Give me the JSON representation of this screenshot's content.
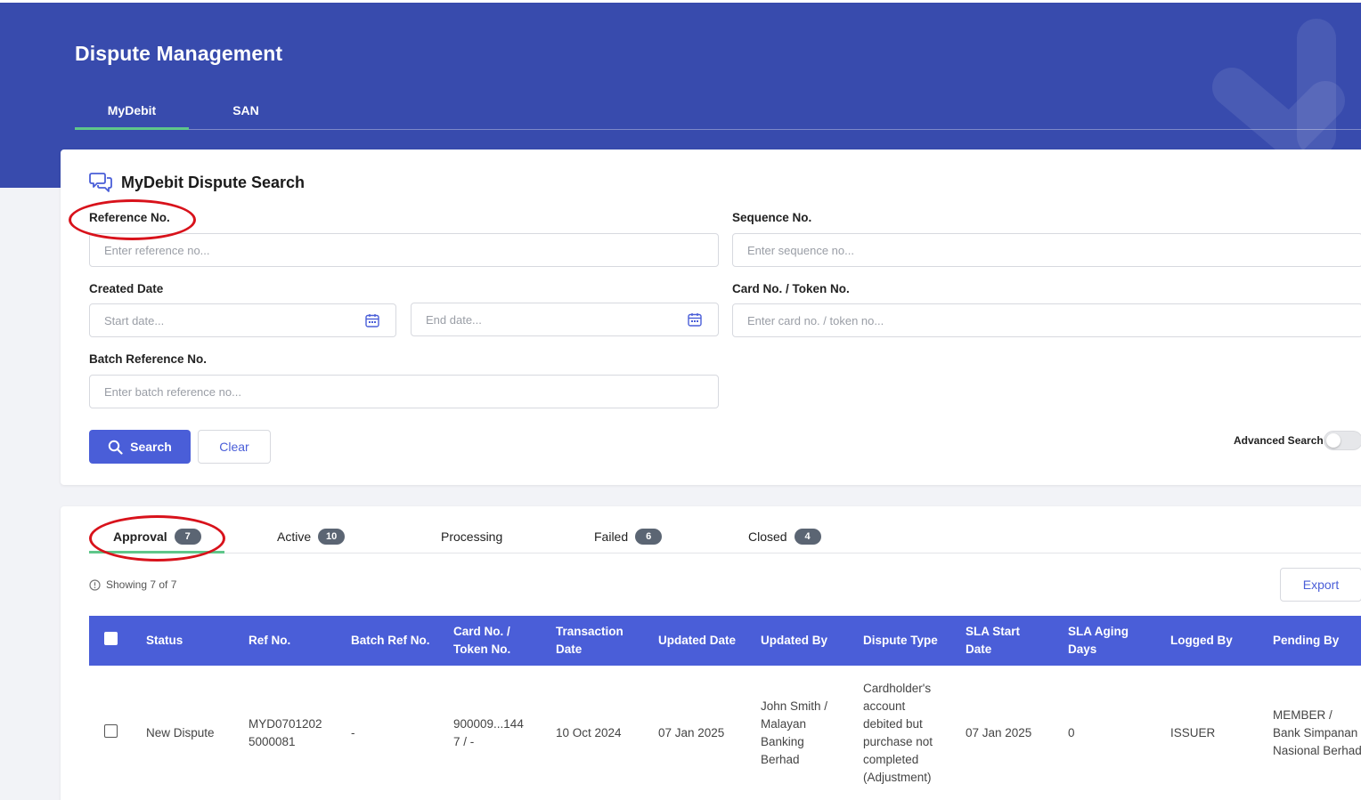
{
  "page": {
    "title": "Dispute Management"
  },
  "top_tabs": [
    {
      "label": "MyDebit",
      "active": true
    },
    {
      "label": "SAN",
      "active": false
    }
  ],
  "search": {
    "heading": "MyDebit Dispute Search",
    "heading_icon": "chat-bubbles-icon",
    "fields": {
      "reference_no": {
        "label": "Reference No.",
        "placeholder": "Enter reference no..."
      },
      "sequence_no": {
        "label": "Sequence No.",
        "placeholder": "Enter sequence no..."
      },
      "created_date": {
        "label": "Created Date",
        "start_placeholder": "Start date...",
        "end_placeholder": "End date..."
      },
      "card_token_no": {
        "label": "Card No. / Token No.",
        "placeholder": "Enter card no. / token no..."
      },
      "batch_reference_no": {
        "label": "Batch Reference No.",
        "placeholder": "Enter batch reference no..."
      }
    },
    "search_button": "Search",
    "clear_button": "Clear",
    "advanced_search_label": "Advanced Search",
    "advanced_search_on": false
  },
  "results": {
    "tabs": [
      {
        "label": "Approval",
        "count": "7",
        "active": true
      },
      {
        "label": "Active",
        "count": "10",
        "active": false
      },
      {
        "label": "Processing",
        "count": "",
        "active": false
      },
      {
        "label": "Failed",
        "count": "6",
        "active": false
      },
      {
        "label": "Closed",
        "count": "4",
        "active": false
      }
    ],
    "showing_text": "Showing 7 of 7",
    "export_button": "Export",
    "columns": [
      "Status",
      "Ref No.",
      "Batch Ref No.",
      "Card No. / Token No.",
      "Transaction Date",
      "Updated Date",
      "Updated By",
      "Dispute Type",
      "SLA Start Date",
      "SLA Aging Days",
      "Logged By",
      "Pending By"
    ],
    "rows": [
      {
        "status": "New Dispute",
        "ref_no": "MYD0701202 5000081",
        "batch_ref_no": "-",
        "card_token_no": "900009...144 7 / -",
        "transaction_date": "10 Oct 2024",
        "updated_date": "07 Jan 2025",
        "updated_by": "John Smith / Malayan Banking Berhad",
        "dispute_type": "Cardholder's account debited but purchase not completed (Adjustment)",
        "sla_start_date": "07 Jan 2025",
        "sla_aging_days": "0",
        "logged_by": "ISSUER",
        "pending_by": "MEMBER / Bank Simpanan Nasional Berhad"
      }
    ]
  },
  "colors": {
    "banner": "#384bad",
    "primary": "#4a5ed8",
    "active_tab_underline": "#5fc68a",
    "badge": "#5b6573",
    "annotation": "#d8121b"
  }
}
